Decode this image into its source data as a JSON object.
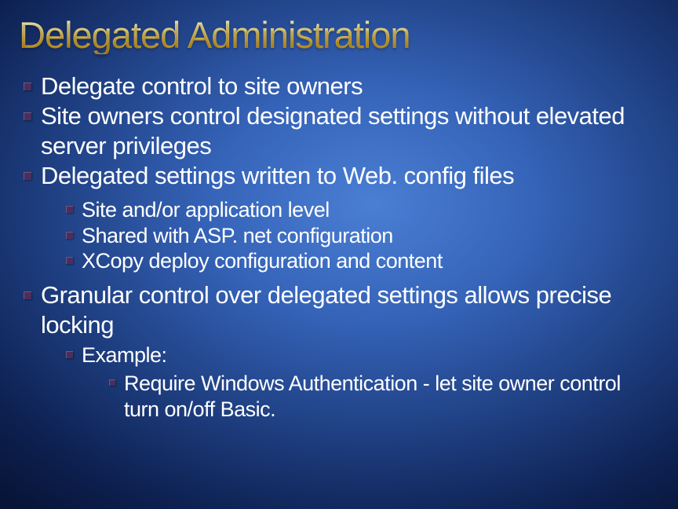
{
  "title": "Delegated Administration",
  "bullets": {
    "l1_a": "Delegate control to site owners",
    "l1_b": "Site owners control designated settings without elevated server privileges",
    "l1_c": "Delegated settings written to Web. config files",
    "l2_a": "Site and/or application level",
    "l2_b": "Shared with ASP. net configuration",
    "l2_c": "XCopy  deploy configuration and content",
    "l1_d": "Granular control over delegated settings allows precise locking",
    "l2_d": "Example:",
    "l3_a": "Require Windows Authentication - let site owner control turn on/off Basic."
  }
}
